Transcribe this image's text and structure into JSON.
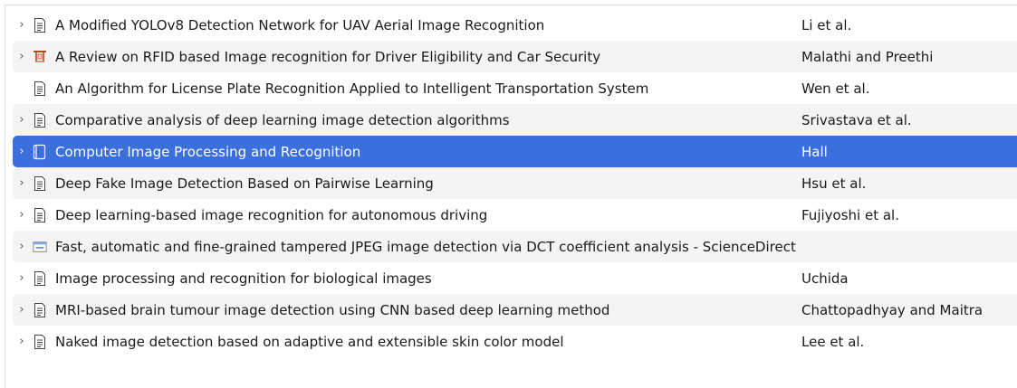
{
  "items": [
    {
      "title": "A Modified YOLOv8 Detection Network for UAV Aerial Image Recognition",
      "creator": "Li et al.",
      "icon": "journal-article-icon",
      "expandable": true
    },
    {
      "title": "A Review on RFID based Image recognition for Driver Eligibility and Car Security",
      "creator": "Malathi and Preethi",
      "icon": "conference-paper-icon",
      "expandable": true
    },
    {
      "title": "An Algorithm for License Plate Recognition Applied to Intelligent Transportation System",
      "creator": "Wen et al.",
      "icon": "journal-article-icon",
      "expandable": false
    },
    {
      "title": "Comparative analysis of deep learning image detection algorithms",
      "creator": "Srivastava et al.",
      "icon": "journal-article-icon",
      "expandable": true
    },
    {
      "title": "Computer Image Processing and Recognition",
      "creator": "Hall",
      "icon": "book-icon",
      "expandable": true,
      "selected": true
    },
    {
      "title": "Deep Fake Image Detection Based on Pairwise Learning",
      "creator": "Hsu et al.",
      "icon": "journal-article-icon",
      "expandable": true
    },
    {
      "title": "Deep learning-based image recognition for autonomous driving",
      "creator": "Fujiyoshi et al.",
      "icon": "journal-article-icon",
      "expandable": true
    },
    {
      "title": "Fast, automatic and fine-grained tampered JPEG image detection via DCT coefficient analysis - ScienceDirect",
      "creator": "",
      "icon": "web-page-icon",
      "expandable": true
    },
    {
      "title": "Image processing and recognition for biological images",
      "creator": "Uchida",
      "icon": "journal-article-icon",
      "expandable": true
    },
    {
      "title": "MRI-based brain tumour image detection using CNN based deep learning method",
      "creator": "Chattopadhyay and Maitra",
      "icon": "journal-article-icon",
      "expandable": true
    },
    {
      "title": "Naked image detection based on adaptive and extensible skin color model",
      "creator": "Lee et al.",
      "icon": "journal-article-icon",
      "expandable": true
    }
  ],
  "colors": {
    "selection": "#3b6fde",
    "alt_row": "#f4f4f4"
  }
}
